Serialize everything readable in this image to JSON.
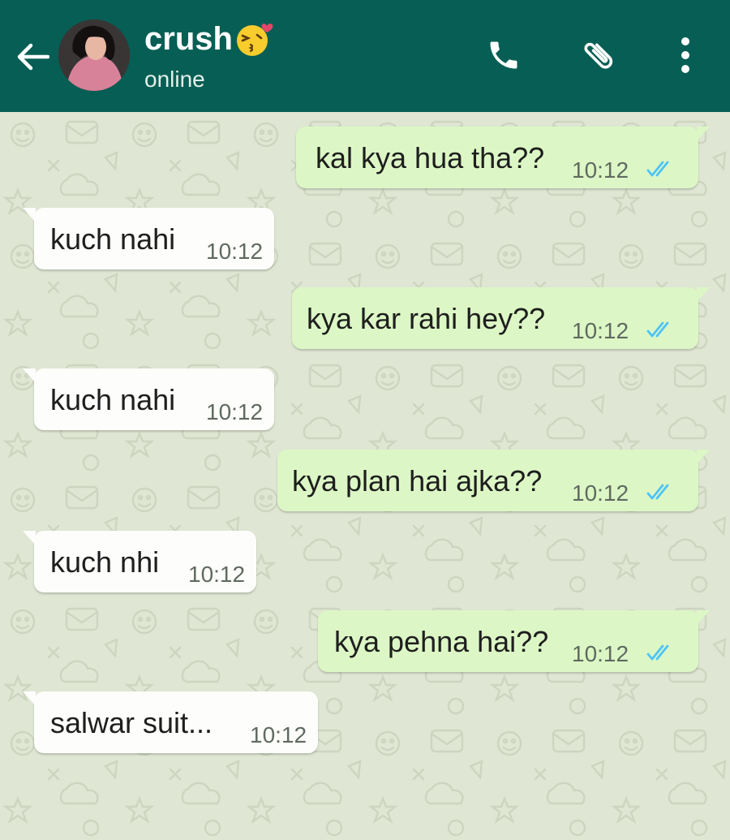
{
  "header": {
    "contact_name": "crush",
    "status": "online"
  },
  "icons": {
    "back": "arrow-left-icon",
    "avatar": "contact-avatar",
    "emoji": "kissing-face-emoji",
    "call": "phone-icon",
    "attach": "paperclip-icon",
    "menu": "more-vertical-icon",
    "read_receipt": "double-check-icon"
  },
  "colors": {
    "header": "#075e54",
    "outgoing_bubble": "#dcf7c5",
    "incoming_bubble": "#fdfdfb",
    "read_ticks": "#4fc3f7"
  },
  "messages": [
    {
      "direction": "out",
      "text": "kal kya hua tha??",
      "time": "10:12"
    },
    {
      "direction": "in",
      "text": "kuch nahi",
      "time": "10:12"
    },
    {
      "direction": "out",
      "text": "kya kar rahi hey??",
      "time": "10:12"
    },
    {
      "direction": "in",
      "text": "kuch nahi",
      "time": "10:12"
    },
    {
      "direction": "out",
      "text": "kya plan hai ajka??",
      "time": "10:12"
    },
    {
      "direction": "in",
      "text": "kuch nhi",
      "time": "10:12"
    },
    {
      "direction": "out",
      "text": "kya pehna hai??",
      "time": "10:12"
    },
    {
      "direction": "in",
      "text": "salwar suit...",
      "time": "10:12"
    }
  ]
}
